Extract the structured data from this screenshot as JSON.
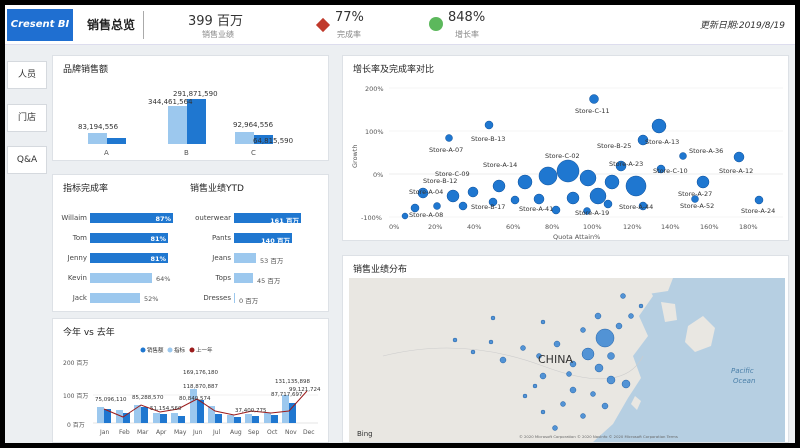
{
  "header": {
    "logo": "Cresent BI",
    "title": "销售总览",
    "kpi1_value": "399 百万",
    "kpi1_label": "销售业绩",
    "kpi2_value": "77%",
    "kpi2_label": "完成率",
    "kpi3_value": "848%",
    "kpi3_label": "增长率",
    "update": "更新日期:2019/8/19"
  },
  "nav": [
    "人员",
    "门店",
    "Q&A"
  ],
  "brand_sales": {
    "title": "品牌销售额",
    "categories": [
      "A",
      "B",
      "C"
    ],
    "labels_light": [
      "83,194,556",
      "344,461,564",
      "92,964,556"
    ],
    "labels_dark": [
      "",
      "291,871,590",
      "64,815,590"
    ]
  },
  "completion": {
    "title": "指标完成率",
    "rows": [
      {
        "name": "Willaim",
        "value": "87%"
      },
      {
        "name": "Tom",
        "value": "81%"
      },
      {
        "name": "Jenny",
        "value": "81%"
      },
      {
        "name": "Kevin",
        "value": "64%"
      },
      {
        "name": "Jack",
        "value": "52%"
      }
    ]
  },
  "ytd": {
    "title": "销售业绩YTD",
    "rows": [
      {
        "name": "outerwear",
        "value": "161 百万"
      },
      {
        "name": "Pants",
        "value": "140 百万"
      },
      {
        "name": "Jeans",
        "value": "53 百万"
      },
      {
        "name": "Tops",
        "value": "45 百万"
      },
      {
        "name": "Dresses",
        "value": "0 百万"
      }
    ]
  },
  "yoy": {
    "title": "今年 vs 去年",
    "legend": [
      "销售额",
      "指标",
      "上一年"
    ],
    "months": [
      "Jan",
      "Feb",
      "Mar",
      "Apr",
      "May",
      "Jun",
      "Jul",
      "Aug",
      "Sep",
      "Oct",
      "Nov",
      "Dec"
    ],
    "yticks": [
      "200 百万",
      "100 百万",
      "0 百万"
    ],
    "labels": [
      "75,096,110",
      "85,288,570",
      "51,154,560",
      "169,176,180",
      "118,870,887",
      "80,840,574",
      "37,400,775",
      "131,135,898",
      "87,717,697",
      "99,121,724"
    ]
  },
  "scatter": {
    "title": "增长率及完成率对比",
    "xlabel": "Quota Attain%",
    "ylabel": "Growth",
    "xticks": [
      "0%",
      "20%",
      "40%",
      "60%",
      "80%",
      "100%",
      "120%",
      "140%",
      "160%",
      "180%"
    ],
    "yticks": [
      "200%",
      "100%",
      "0%",
      "-100%"
    ],
    "store_labels": [
      "Store-C-11",
      "Store-A-07",
      "Store-B-13",
      "Store-B-25",
      "Store-A-13",
      "Store-A-36",
      "Store-C-02",
      "Store-A-14",
      "Store-C-09",
      "Store-A-23",
      "Store-C-10",
      "Store-A-12",
      "Store-B-12",
      "Store-A-44",
      "Store-A-27",
      "Store-B-17",
      "Store-A-41",
      "Store-A-52",
      "Store-A-19",
      "Store-A-24",
      "Store-A-08",
      "Store-A-04"
    ]
  },
  "map": {
    "title": "销售业绩分布",
    "country": "CHINA",
    "ocean": "Pacific Ocean",
    "bing": "Bing",
    "copyright": "© 2020 Microsoft Corporation  © 2020 NavInfo  © 2020 Microsoft Corporation Terms"
  },
  "colors": {
    "accent": "#1f77d0",
    "light": "#9cc8ee",
    "red": "#c0392b",
    "green": "#5cb85c"
  }
}
